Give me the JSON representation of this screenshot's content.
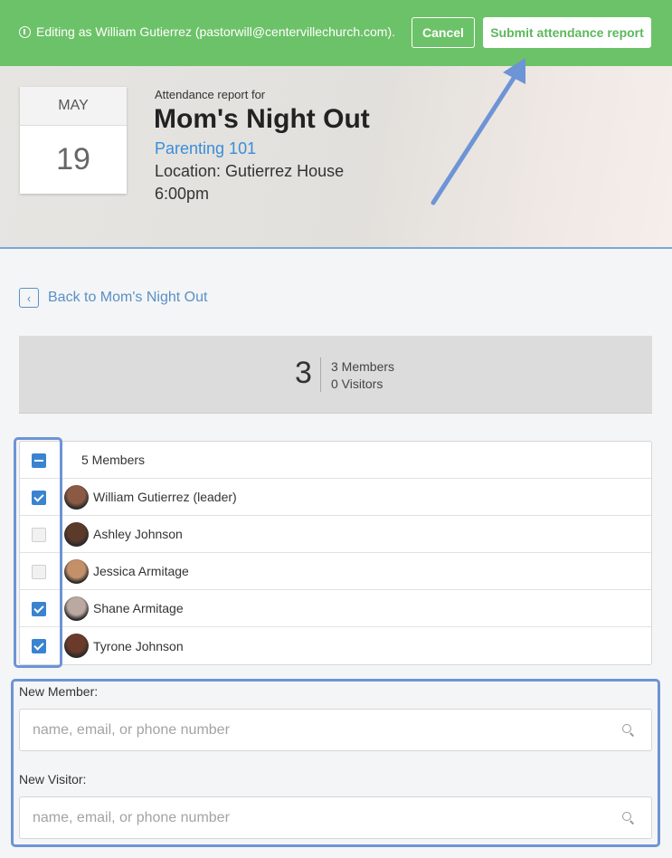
{
  "topbar": {
    "notice": "Editing as William Gutierrez (pastorwill@centervillechurch.com).",
    "cancel_label": "Cancel",
    "submit_label": "Submit attendance report"
  },
  "event": {
    "month": "MAY",
    "day": "19",
    "subtitle": "Attendance report for",
    "title": "Mom's Night Out",
    "group": "Parenting 101",
    "location": "Location: Gutierrez House",
    "time": "6:00pm"
  },
  "back_link": "Back to Mom's Night Out",
  "summary": {
    "total": "3",
    "members_line": "3 Members",
    "visitors_line": "0 Visitors"
  },
  "members": {
    "header": "5 Members",
    "rows": [
      {
        "name": "William Gutierrez (leader)",
        "checked": true,
        "avatar_color": "#8a5a44"
      },
      {
        "name": "Ashley Johnson",
        "checked": false,
        "avatar_color": "#5b3a2a"
      },
      {
        "name": "Jessica Armitage",
        "checked": false,
        "avatar_color": "#c4906a"
      },
      {
        "name": "Shane Armitage",
        "checked": true,
        "avatar_color": "#b9a9a0"
      },
      {
        "name": "Tyrone Johnson",
        "checked": true,
        "avatar_color": "#6a3a2a"
      }
    ]
  },
  "new_member": {
    "label": "New Member:",
    "placeholder": "name, email, or phone number"
  },
  "new_visitor": {
    "label": "New Visitor:",
    "placeholder": "name, email, or phone number"
  },
  "colors": {
    "brand_green": "#6cc268",
    "accent_blue": "#3a83d0",
    "annotation_blue": "#6d94d6"
  }
}
